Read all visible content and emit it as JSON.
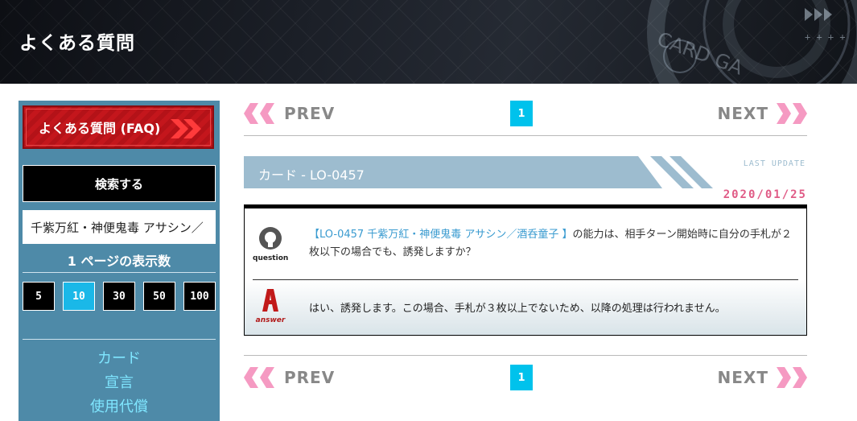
{
  "header": {
    "title": "よくある質問"
  },
  "sidebar": {
    "faq_label": "よくある質問 (FAQ)",
    "search_label": "検索する",
    "search_value": "千紫万紅・神便鬼毒 アサシン／",
    "per_page_label": "1 ページの表示数",
    "per_page_options": [
      "5",
      "10",
      "30",
      "50",
      "100"
    ],
    "per_page_selected": "10",
    "links": [
      "カード",
      "宣言",
      "使用代償"
    ]
  },
  "pager": {
    "prev": "PREV",
    "next": "NEXT",
    "current": "1"
  },
  "card": {
    "title": "カード - LO-0457",
    "last_update_label": "LAST UPDATE",
    "date": "2020/01/25"
  },
  "qa": {
    "question_caption": "question",
    "answer_caption": "answer",
    "question_link": "【LO-0457 千紫万紅・神便鬼毒 アサシン／酒呑童子 】",
    "question_rest": "の能力は、相手ターン開始時に自分の手札が２枚以下の場合でも、誘発しますか？",
    "answer": "はい、誘発します。この場合、手札が３枚以上でないため、以降の処理は行われません。"
  },
  "colors": {
    "accent": "#00c2ec",
    "sidebar": "#4e8aa8",
    "faq_red": "#c4161c",
    "date_pink": "#e05b86",
    "arrow_pink": "#f59ac2"
  }
}
